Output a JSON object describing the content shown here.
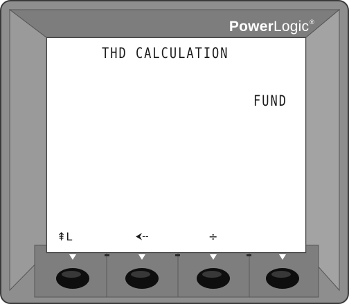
{
  "brand": {
    "part1": "Power",
    "part2": "Logic",
    "reg": "®"
  },
  "screen": {
    "title": "THD CALCULATION",
    "value": "FUND"
  },
  "softkeys": [
    {
      "label": "⇞L",
      "icon": "phase-up-icon"
    },
    {
      "label": "⮜--",
      "icon": "back-arrow-icon"
    },
    {
      "label": "÷",
      "icon": "divide-icon"
    },
    {
      "label": "",
      "icon": "blank"
    }
  ],
  "colors": {
    "bezel": "#8c8c8c",
    "bezel_light": "#b8b8b8",
    "bezel_dark": "#6a6a6a",
    "button": "#1a1a1a"
  }
}
